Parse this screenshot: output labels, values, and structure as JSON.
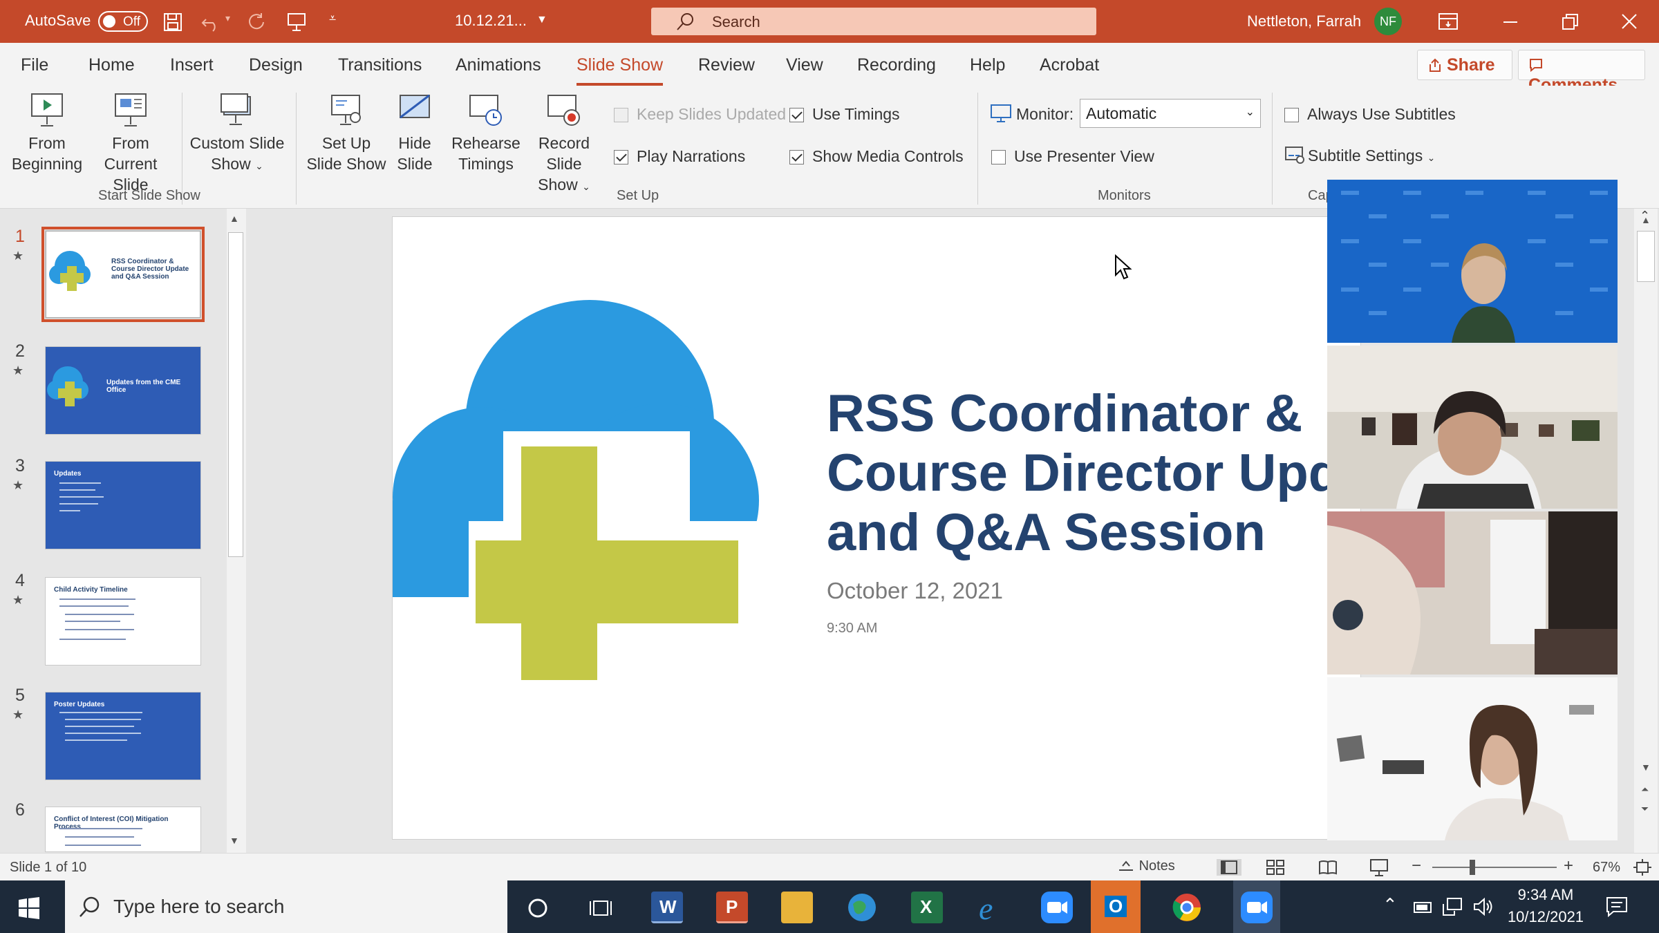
{
  "titlebar": {
    "autosave_label": "AutoSave",
    "autosave_state": "Off",
    "doc_name": "10.12.21...",
    "search_placeholder": "Search",
    "user_name": "Nettleton, Farrah",
    "user_initials": "NF"
  },
  "menu": {
    "tabs": [
      "File",
      "Home",
      "Insert",
      "Design",
      "Transitions",
      "Animations",
      "Slide Show",
      "Review",
      "View",
      "Recording",
      "Help",
      "Acrobat"
    ],
    "active_tab": "Slide Show",
    "share_label": "Share",
    "comments_label": "Comments"
  },
  "ribbon": {
    "from_beginning": [
      "From",
      "Beginning"
    ],
    "from_current": [
      "From",
      "Current Slide"
    ],
    "custom_show": [
      "Custom Slide",
      "Show"
    ],
    "group_start": "Start Slide Show",
    "setup_show": [
      "Set Up",
      "Slide Show"
    ],
    "hide_slide": [
      "Hide",
      "Slide"
    ],
    "rehearse": [
      "Rehearse",
      "Timings"
    ],
    "record": [
      "Record Slide",
      "Show"
    ],
    "keep_updated": "Keep Slides Updated",
    "use_timings": "Use Timings",
    "play_narrations": "Play Narrations",
    "show_media": "Show Media Controls",
    "group_setup": "Set Up",
    "monitor_label": "Monitor:",
    "monitor_value": "Automatic",
    "presenter_view": "Use Presenter View",
    "group_monitors": "Monitors",
    "always_subtitles": "Always Use Subtitles",
    "subtitle_settings": "Subtitle Settings",
    "group_captions": "Cap"
  },
  "thumbnails": [
    {
      "num": "1",
      "title": "RSS Coordinator & Course Director Update and Q&A Session"
    },
    {
      "num": "2",
      "title": "Updates from the CME Office"
    },
    {
      "num": "3",
      "title": "Updates"
    },
    {
      "num": "4",
      "title": "Child Activity Timeline"
    },
    {
      "num": "5",
      "title": "Poster Updates"
    },
    {
      "num": "6",
      "title": "Conflict of Interest (COI) Mitigation Process"
    }
  ],
  "slide": {
    "title_lines": [
      "RSS Coordinator &",
      "Course Director Upd",
      "and Q&A Session"
    ],
    "date": "October 12, 2021",
    "time": "9:30 AM",
    "colors": {
      "cloud": "#2b9ae0",
      "cross": "#c4c847",
      "title": "#24436f"
    }
  },
  "status": {
    "slide_indicator": "Slide 1 of 10",
    "notes_label": "Notes",
    "zoom": "67%"
  },
  "taskbar": {
    "search_placeholder": "Type here to search",
    "time": "9:34 AM",
    "date": "10/12/2021"
  }
}
